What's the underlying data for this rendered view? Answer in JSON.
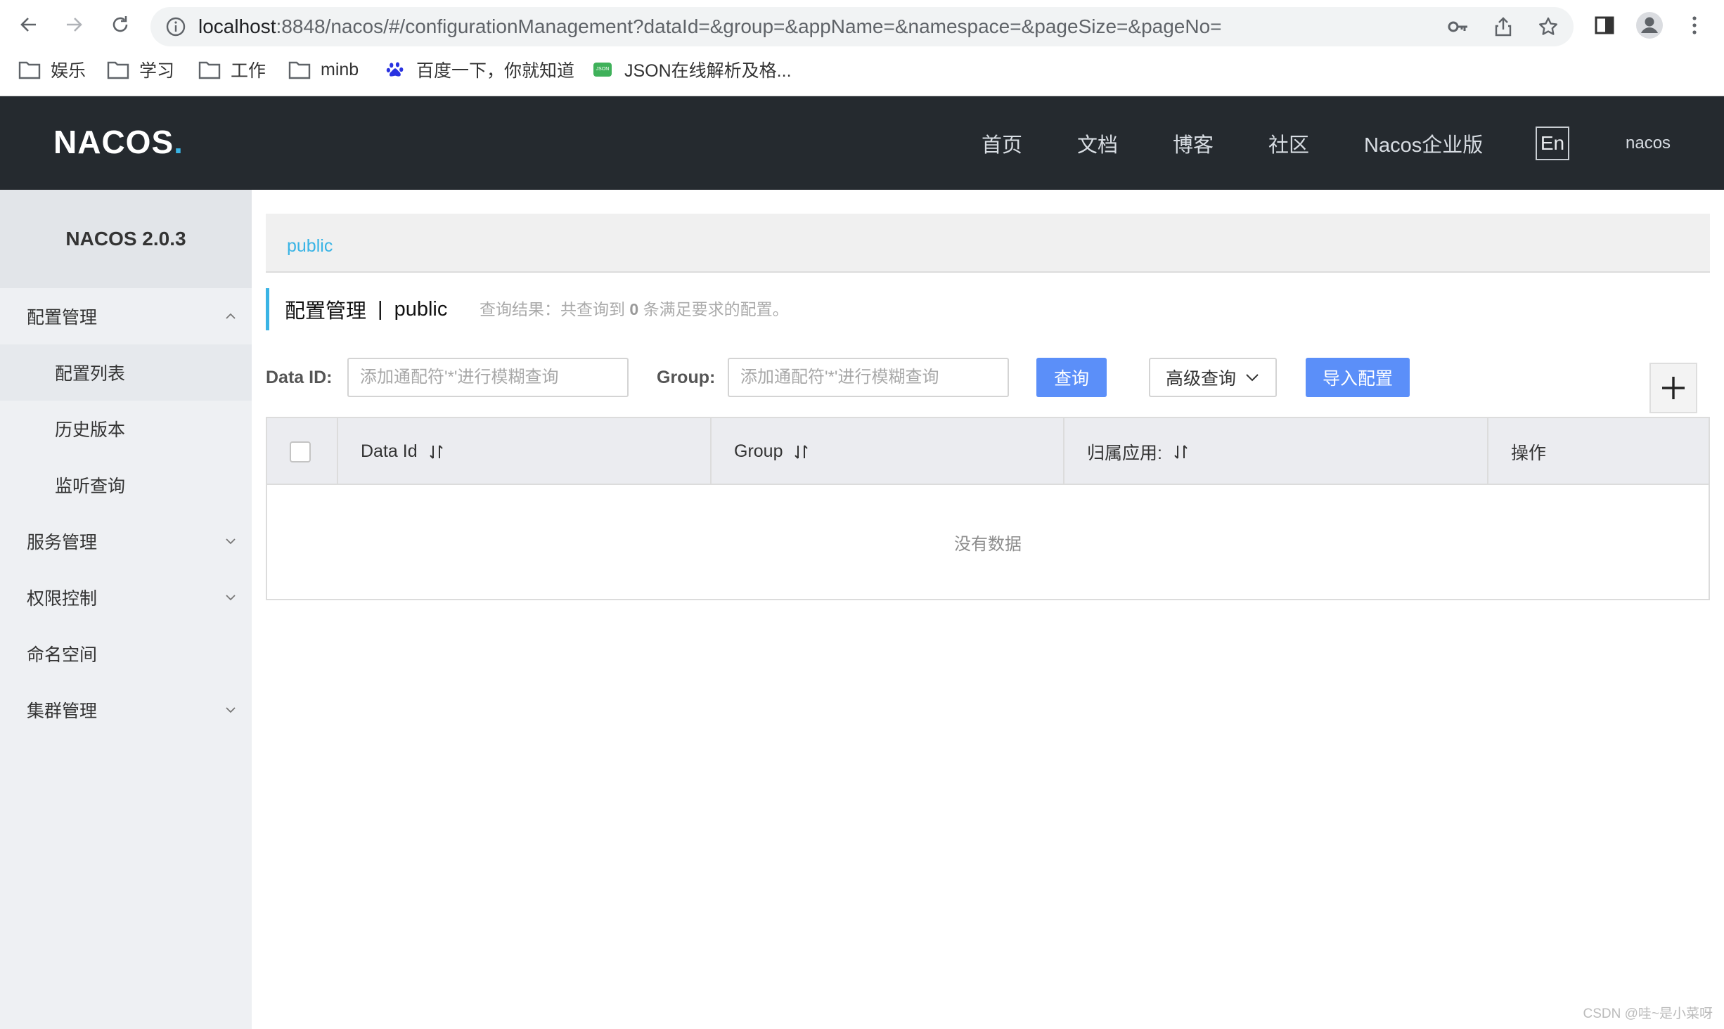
{
  "browser": {
    "url_host": "localhost",
    "url_rest": ":8848/nacos/#/configurationManagement?dataId=&group=&appName=&namespace=&pageSize=&pageNo=",
    "bookmarks": [
      "娱乐",
      "学习",
      "工作",
      "minb",
      "百度一下，你就知道",
      "JSON在线解析及格..."
    ],
    "json_icon_text": "JSON"
  },
  "header": {
    "logo_text": "NACOS",
    "logo_dot": ".",
    "nav": [
      "首页",
      "文档",
      "博客",
      "社区",
      "Nacos企业版"
    ],
    "lang": "En",
    "user": "nacos"
  },
  "sidebar": {
    "title": "NACOS 2.0.3",
    "items": [
      {
        "label": "配置管理"
      },
      {
        "label": "配置列表"
      },
      {
        "label": "历史版本"
      },
      {
        "label": "监听查询"
      },
      {
        "label": "服务管理"
      },
      {
        "label": "权限控制"
      },
      {
        "label": "命名空间"
      },
      {
        "label": "集群管理"
      }
    ]
  },
  "main": {
    "namespace_tab": "public",
    "title": "配置管理",
    "title_sep": "|",
    "title_ns": "public",
    "query_result_prefix": "查询结果：共查询到",
    "query_result_count": "0",
    "query_result_suffix": "条满足要求的配置。",
    "dataid_label": "Data ID:",
    "dataid_placeholder": "添加通配符'*'进行模糊查询",
    "group_label": "Group:",
    "group_placeholder": "添加通配符'*'进行模糊查询",
    "search_button": "查询",
    "advanced_button": "高级查询",
    "import_button": "导入配置",
    "columns": [
      "Data Id",
      "Group",
      "归属应用:",
      "操作"
    ],
    "empty_text": "没有数据"
  },
  "colors": {
    "header_bg": "#252a2f",
    "accent": "#3ab4e5",
    "primary_button": "#5b8ff9"
  },
  "watermark": "CSDN @哇~是小菜呀"
}
